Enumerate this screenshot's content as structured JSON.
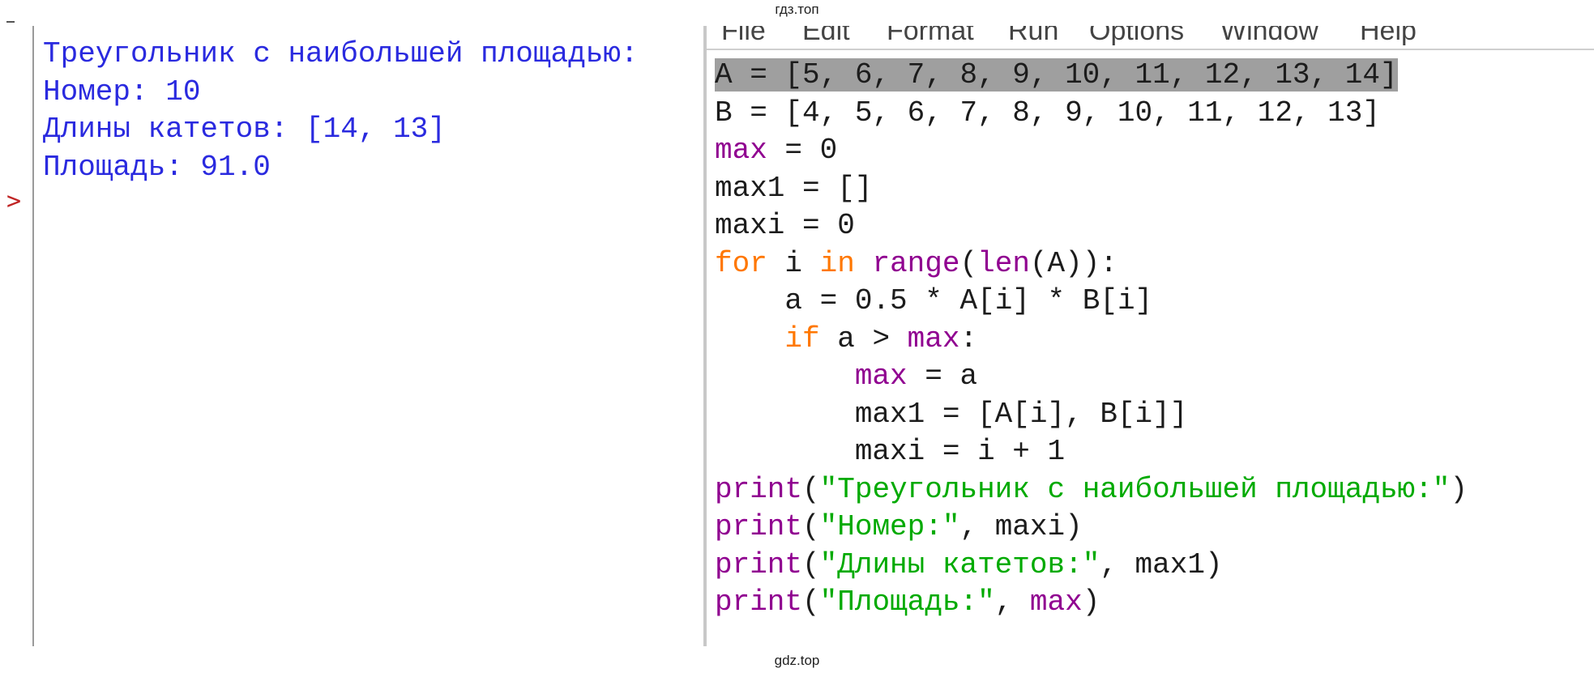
{
  "watermark": {
    "top": "гдз.топ",
    "bottom": "gdz.top"
  },
  "shell": {
    "output_lines": [
      "Треугольник с наибольшей площадью:",
      "Номер: 10",
      "Длины катетов: [14, 13]",
      "Площадь: 91.0"
    ],
    "prompt": ">",
    "prompt_color": "#c02525",
    "output_color": "#2a2adf"
  },
  "editor": {
    "menu": [
      "File",
      "Edit",
      "Format",
      "Run",
      "Options",
      "Window",
      "Help"
    ],
    "colors": {
      "keyword": "#ff7700",
      "builtin": "#900090",
      "string": "#00aa00",
      "selection": "#9f9f9f"
    },
    "code_lines": [
      "A = [5, 6, 7, 8, 9, 10, 11, 12, 13, 14]",
      "B = [4, 5, 6, 7, 8, 9, 10, 11, 12, 13]",
      "max = 0",
      "max1 = []",
      "maxi = 0",
      "for i in range(len(A)):",
      "    a = 0.5 * A[i] * B[i]",
      "    if a > max:",
      "        max = a",
      "        max1 = [A[i], B[i]]",
      "        maxi = i + 1",
      "print(\"Треугольник с наибольшей площадью:\")",
      "print(\"Номер:\", maxi)",
      "print(\"Длины катетов:\", max1)",
      "print(\"Площадь:\", max)"
    ]
  }
}
